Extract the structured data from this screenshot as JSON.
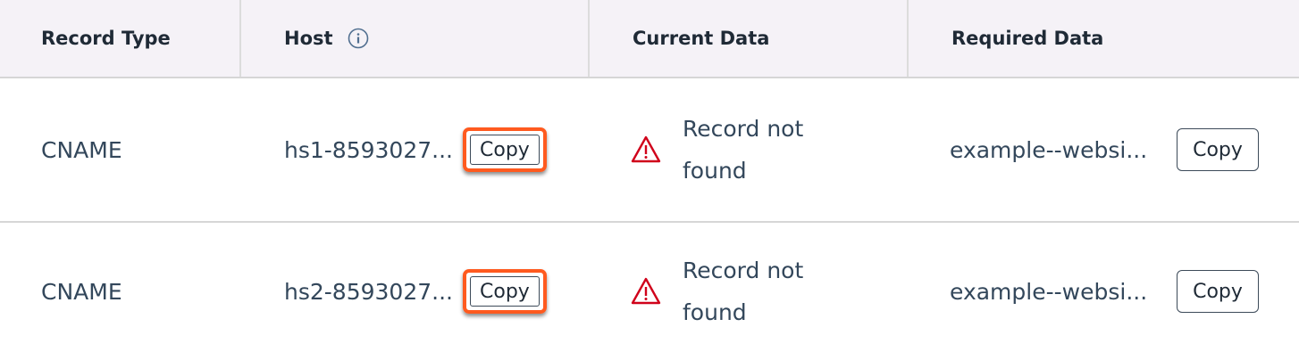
{
  "header": {
    "record_type": "Record Type",
    "host": "Host",
    "current_data": "Current Data",
    "required_data": "Required Data"
  },
  "colors": {
    "highlight": "#ff5a1f",
    "warning": "#d0021b",
    "header_bg": "#f5f2f7",
    "text": "#33475b"
  },
  "rows": [
    {
      "record_type": "CNAME",
      "host": "hs1-8593027....",
      "copy_label": "Copy",
      "status_icon": "warning-icon",
      "current_data": "Record not found",
      "required_data": "example--websi...",
      "required_copy_label": "Copy"
    },
    {
      "record_type": "CNAME",
      "host": "hs2-8593027....",
      "copy_label": "Copy",
      "status_icon": "warning-icon",
      "current_data": "Record not found",
      "required_data": "example--websi...",
      "required_copy_label": "Copy"
    }
  ]
}
